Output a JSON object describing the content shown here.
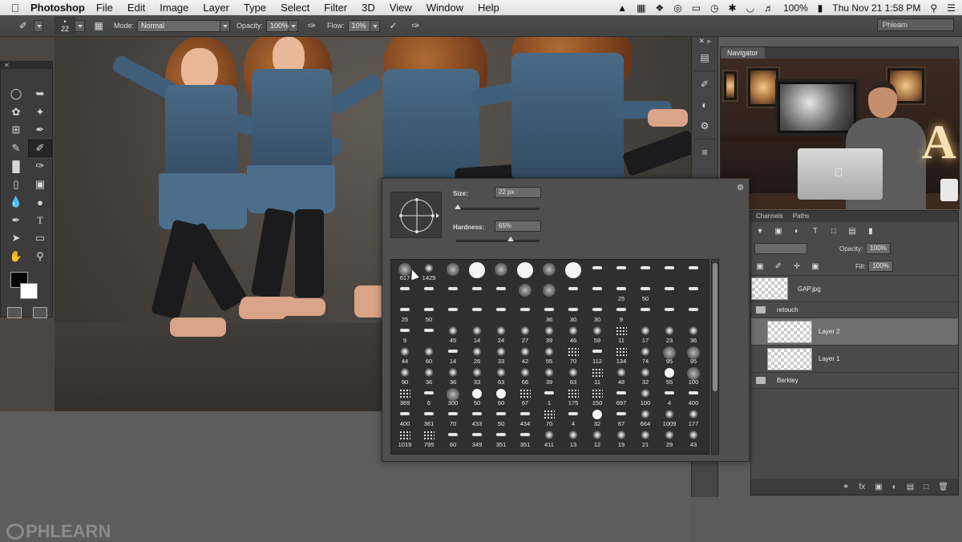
{
  "menubar": {
    "app_name": "Photoshop",
    "items": [
      "File",
      "Edit",
      "Image",
      "Layer",
      "Type",
      "Select",
      "Filter",
      "3D",
      "View",
      "Window",
      "Help"
    ],
    "battery": "100%",
    "clock": "Thu Nov 21  1:58 PM"
  },
  "options_bar": {
    "brush_size": "22",
    "mode_label": "Mode:",
    "mode_value": "Normal",
    "opacity_label": "Opacity:",
    "opacity_value": "100%",
    "flow_label": "Flow:",
    "flow_value": "10%",
    "workspace": "Phlearn"
  },
  "brush_picker": {
    "size_label": "Size:",
    "size_value": "22 px",
    "size_fraction": 0.02,
    "hardness_label": "Hardness:",
    "hardness_value": "65%",
    "hardness_fraction": 0.65,
    "presets": [
      {
        "k": "soft",
        "n": "617"
      },
      {
        "k": "tex",
        "n": "1429"
      },
      {
        "k": "soft",
        "n": ""
      },
      {
        "k": "hard",
        "n": ""
      },
      {
        "k": "soft",
        "n": ""
      },
      {
        "k": "hard",
        "n": ""
      },
      {
        "k": "soft",
        "n": ""
      },
      {
        "k": "hard",
        "n": ""
      },
      {
        "k": "stroke",
        "n": ""
      },
      {
        "k": "stroke",
        "n": ""
      },
      {
        "k": "stroke",
        "n": ""
      },
      {
        "k": "stroke",
        "n": ""
      },
      {
        "k": "stroke",
        "n": ""
      },
      {
        "k": "stroke",
        "n": ""
      },
      {
        "k": "stroke",
        "n": ""
      },
      {
        "k": "stroke",
        "n": ""
      },
      {
        "k": "stroke",
        "n": ""
      },
      {
        "k": "stroke",
        "n": ""
      },
      {
        "k": "soft",
        "n": ""
      },
      {
        "k": "soft",
        "n": ""
      },
      {
        "k": "stroke",
        "n": ""
      },
      {
        "k": "stroke",
        "n": ""
      },
      {
        "k": "stroke",
        "n": "25"
      },
      {
        "k": "stroke",
        "n": "50"
      },
      {
        "k": "stroke",
        "n": ""
      },
      {
        "k": "stroke",
        "n": ""
      },
      {
        "k": "stroke",
        "n": "25"
      },
      {
        "k": "stroke",
        "n": "50"
      },
      {
        "k": "stroke",
        "n": ""
      },
      {
        "k": "stroke",
        "n": ""
      },
      {
        "k": "stroke",
        "n": ""
      },
      {
        "k": "stroke",
        "n": ""
      },
      {
        "k": "stroke",
        "n": "36"
      },
      {
        "k": "stroke",
        "n": "30"
      },
      {
        "k": "stroke",
        "n": "30"
      },
      {
        "k": "stroke",
        "n": "9"
      },
      {
        "k": "stroke",
        "n": ""
      },
      {
        "k": "stroke",
        "n": ""
      },
      {
        "k": "stroke",
        "n": ""
      },
      {
        "k": "stroke",
        "n": "9"
      },
      {
        "k": "stroke",
        "n": ""
      },
      {
        "k": "tex",
        "n": "45"
      },
      {
        "k": "tex",
        "n": "14"
      },
      {
        "k": "tex",
        "n": "24"
      },
      {
        "k": "tex",
        "n": "27"
      },
      {
        "k": "tex",
        "n": "39"
      },
      {
        "k": "tex",
        "n": "46"
      },
      {
        "k": "tex",
        "n": "59"
      },
      {
        "k": "spec",
        "n": "11"
      },
      {
        "k": "tex",
        "n": "17"
      },
      {
        "k": "tex",
        "n": "23"
      },
      {
        "k": "tex",
        "n": "36"
      },
      {
        "k": "tex",
        "n": "44"
      },
      {
        "k": "tex",
        "n": "60"
      },
      {
        "k": "stroke",
        "n": "14"
      },
      {
        "k": "tex",
        "n": "26"
      },
      {
        "k": "tex",
        "n": "33"
      },
      {
        "k": "tex",
        "n": "42"
      },
      {
        "k": "tex",
        "n": "55"
      },
      {
        "k": "spec",
        "n": "70"
      },
      {
        "k": "stroke",
        "n": "112"
      },
      {
        "k": "spec",
        "n": "134"
      },
      {
        "k": "tex",
        "n": "74"
      },
      {
        "k": "soft",
        "n": "95"
      },
      {
        "k": "soft",
        "n": "95"
      },
      {
        "k": "tex",
        "n": "90"
      },
      {
        "k": "tex",
        "n": "36"
      },
      {
        "k": "tex",
        "n": "36"
      },
      {
        "k": "tex",
        "n": "33"
      },
      {
        "k": "tex",
        "n": "63"
      },
      {
        "k": "tex",
        "n": "66"
      },
      {
        "k": "tex",
        "n": "39"
      },
      {
        "k": "tex",
        "n": "63"
      },
      {
        "k": "spec",
        "n": "11"
      },
      {
        "k": "tex",
        "n": "48"
      },
      {
        "k": "tex",
        "n": "32"
      },
      {
        "k": "hardsm",
        "n": "55"
      },
      {
        "k": "soft",
        "n": "100"
      },
      {
        "k": "spec",
        "n": "369"
      },
      {
        "k": "stroke",
        "n": "6"
      },
      {
        "k": "soft",
        "n": "300"
      },
      {
        "k": "hardsm",
        "n": "50"
      },
      {
        "k": "hardsm",
        "n": "60"
      },
      {
        "k": "spec",
        "n": "67"
      },
      {
        "k": "stroke",
        "n": "1"
      },
      {
        "k": "spec",
        "n": "175"
      },
      {
        "k": "spec",
        "n": "150"
      },
      {
        "k": "stroke",
        "n": "697"
      },
      {
        "k": "tex",
        "n": "100"
      },
      {
        "k": "stroke",
        "n": "4"
      },
      {
        "k": "stroke",
        "n": "400"
      },
      {
        "k": "stroke",
        "n": "400"
      },
      {
        "k": "stroke",
        "n": "361"
      },
      {
        "k": "stroke",
        "n": "70"
      },
      {
        "k": "stroke",
        "n": "433"
      },
      {
        "k": "stroke",
        "n": "50"
      },
      {
        "k": "stroke",
        "n": "434"
      },
      {
        "k": "spec",
        "n": "70"
      },
      {
        "k": "stroke",
        "n": "4"
      },
      {
        "k": "hardsm",
        "n": "32"
      },
      {
        "k": "stroke",
        "n": "67"
      },
      {
        "k": "tex",
        "n": "664"
      },
      {
        "k": "tex",
        "n": "1009"
      },
      {
        "k": "tex",
        "n": "177"
      },
      {
        "k": "spec",
        "n": "1019"
      },
      {
        "k": "spec",
        "n": "795"
      },
      {
        "k": "stroke",
        "n": "60"
      },
      {
        "k": "stroke",
        "n": "349"
      },
      {
        "k": "stroke",
        "n": "351"
      },
      {
        "k": "stroke",
        "n": "351"
      },
      {
        "k": "tex",
        "n": "411"
      },
      {
        "k": "tex",
        "n": "13"
      },
      {
        "k": "tex",
        "n": "12"
      },
      {
        "k": "tex",
        "n": "19"
      },
      {
        "k": "tex",
        "n": "21"
      },
      {
        "k": "tex",
        "n": "29"
      },
      {
        "k": "tex",
        "n": "43"
      }
    ]
  },
  "navigator": {
    "tab": "Navigator"
  },
  "layers_panel": {
    "tabs": [
      "Channels",
      "Paths"
    ],
    "opacity_label": "Opacity:",
    "opacity_value": "100%",
    "fill_label": "Fill:",
    "fill_value": "100%",
    "layers": [
      {
        "name": "GAP.jpg",
        "type": "layer",
        "selected": false
      },
      {
        "name": "retouch",
        "type": "group",
        "selected": false
      },
      {
        "name": "Layer 2",
        "type": "layer",
        "selected": true
      },
      {
        "name": "Layer 1",
        "type": "layer",
        "selected": false
      },
      {
        "name": "Berkley",
        "type": "group",
        "selected": false
      }
    ]
  },
  "watermark": "PHLEARN",
  "colors": {
    "panel": "#3c3c3c",
    "selected_layer": "#6e6e6e",
    "foreground": "#000000",
    "background": "#ffffff"
  }
}
